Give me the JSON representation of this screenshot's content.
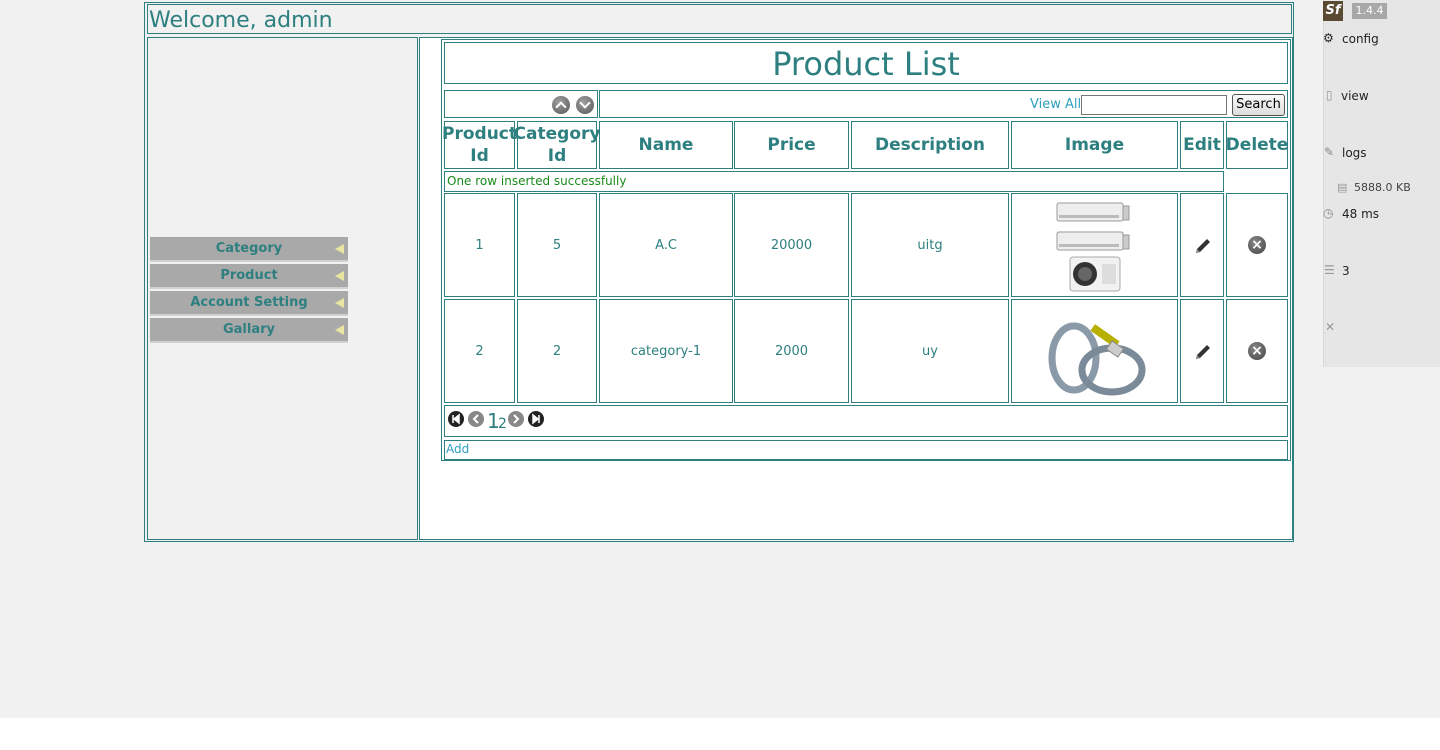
{
  "header": {
    "welcome": "Welcome, admin"
  },
  "sidebar": {
    "items": [
      {
        "label": "Category"
      },
      {
        "label": "Product"
      },
      {
        "label": "Account Setting"
      },
      {
        "label": "Gallary"
      }
    ]
  },
  "main": {
    "title": "Product List",
    "view_all": "View All",
    "search_value": "",
    "search_button": "Search",
    "columns": [
      "Product Id",
      "Category Id",
      "Name",
      "Price",
      "Description",
      "Image",
      "Edit",
      "Delete"
    ],
    "message": "One row inserted successfully",
    "rows": [
      {
        "product_id": "1",
        "category_id": "5",
        "name": "A.C",
        "price": "20000",
        "description": "uitg",
        "image": "air-conditioner-image"
      },
      {
        "product_id": "2",
        "category_id": "2",
        "name": "category-1",
        "price": "2000",
        "description": "uy",
        "image": "cable-image"
      }
    ],
    "pager": {
      "pages": [
        "1",
        "2"
      ]
    },
    "add_link": "Add"
  },
  "debugbar": {
    "version": "1.4.4",
    "logo": "Sf",
    "config": "config",
    "view": "view",
    "logs": "logs",
    "memory": "5888.0 KB",
    "time": "48 ms",
    "db_queries": "3"
  },
  "colors": {
    "accent": "#2e7f80",
    "menu_bg": "#a9a9a9",
    "success": "#1a8a1a",
    "link": "#2e9fc0"
  }
}
